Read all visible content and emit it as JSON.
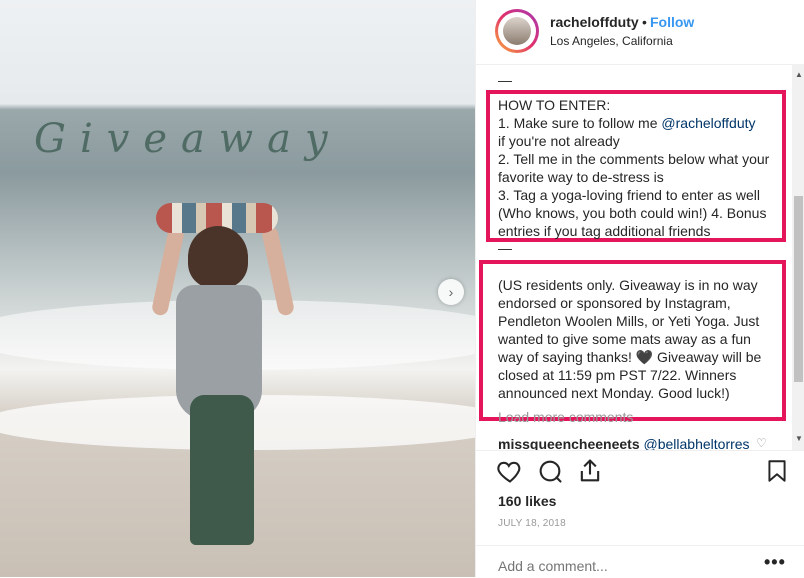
{
  "photo": {
    "overlay_text": "Giveaway",
    "next_icon": "chevron-right-icon"
  },
  "post_header": {
    "username": "racheloffduty",
    "separator": "•",
    "follow_label": "Follow",
    "location": "Los Angeles, California"
  },
  "caption": {
    "separator_top": "—",
    "how_to_enter": "HOW TO ENTER:\n1. Make sure to follow me ",
    "mention": "@racheloffduty",
    "rest": "\nif you're not already\n2. Tell me in the comments below what your favorite way to de-stress is\n3. Tag a yoga-loving friend to enter as well (Who knows, you both could win!) 4. Bonus entries if you tag additional friends",
    "separator_mid": "—",
    "disclaimer": "(US residents only. Giveaway is in no way endorsed or sponsored by Instagram, Pendleton Woolen Mills, or Yeti Yoga. Just wanted to give some mats away as a fun way of saying thanks! 🖤 Giveaway will be closed at 11:59 pm PST 7/22. Winners announced next Monday. Good luck!)"
  },
  "load_more": "Load more comments",
  "comment": {
    "user": "missqueencheeneets",
    "text": "@bellabheltorres"
  },
  "stats": {
    "likes": "160 likes",
    "date": "JULY 18, 2018"
  },
  "add_comment": {
    "placeholder": "Add a comment...",
    "more_label": "•••"
  },
  "colors": {
    "highlight_box": "#e5155b",
    "follow": "#3897f0"
  }
}
